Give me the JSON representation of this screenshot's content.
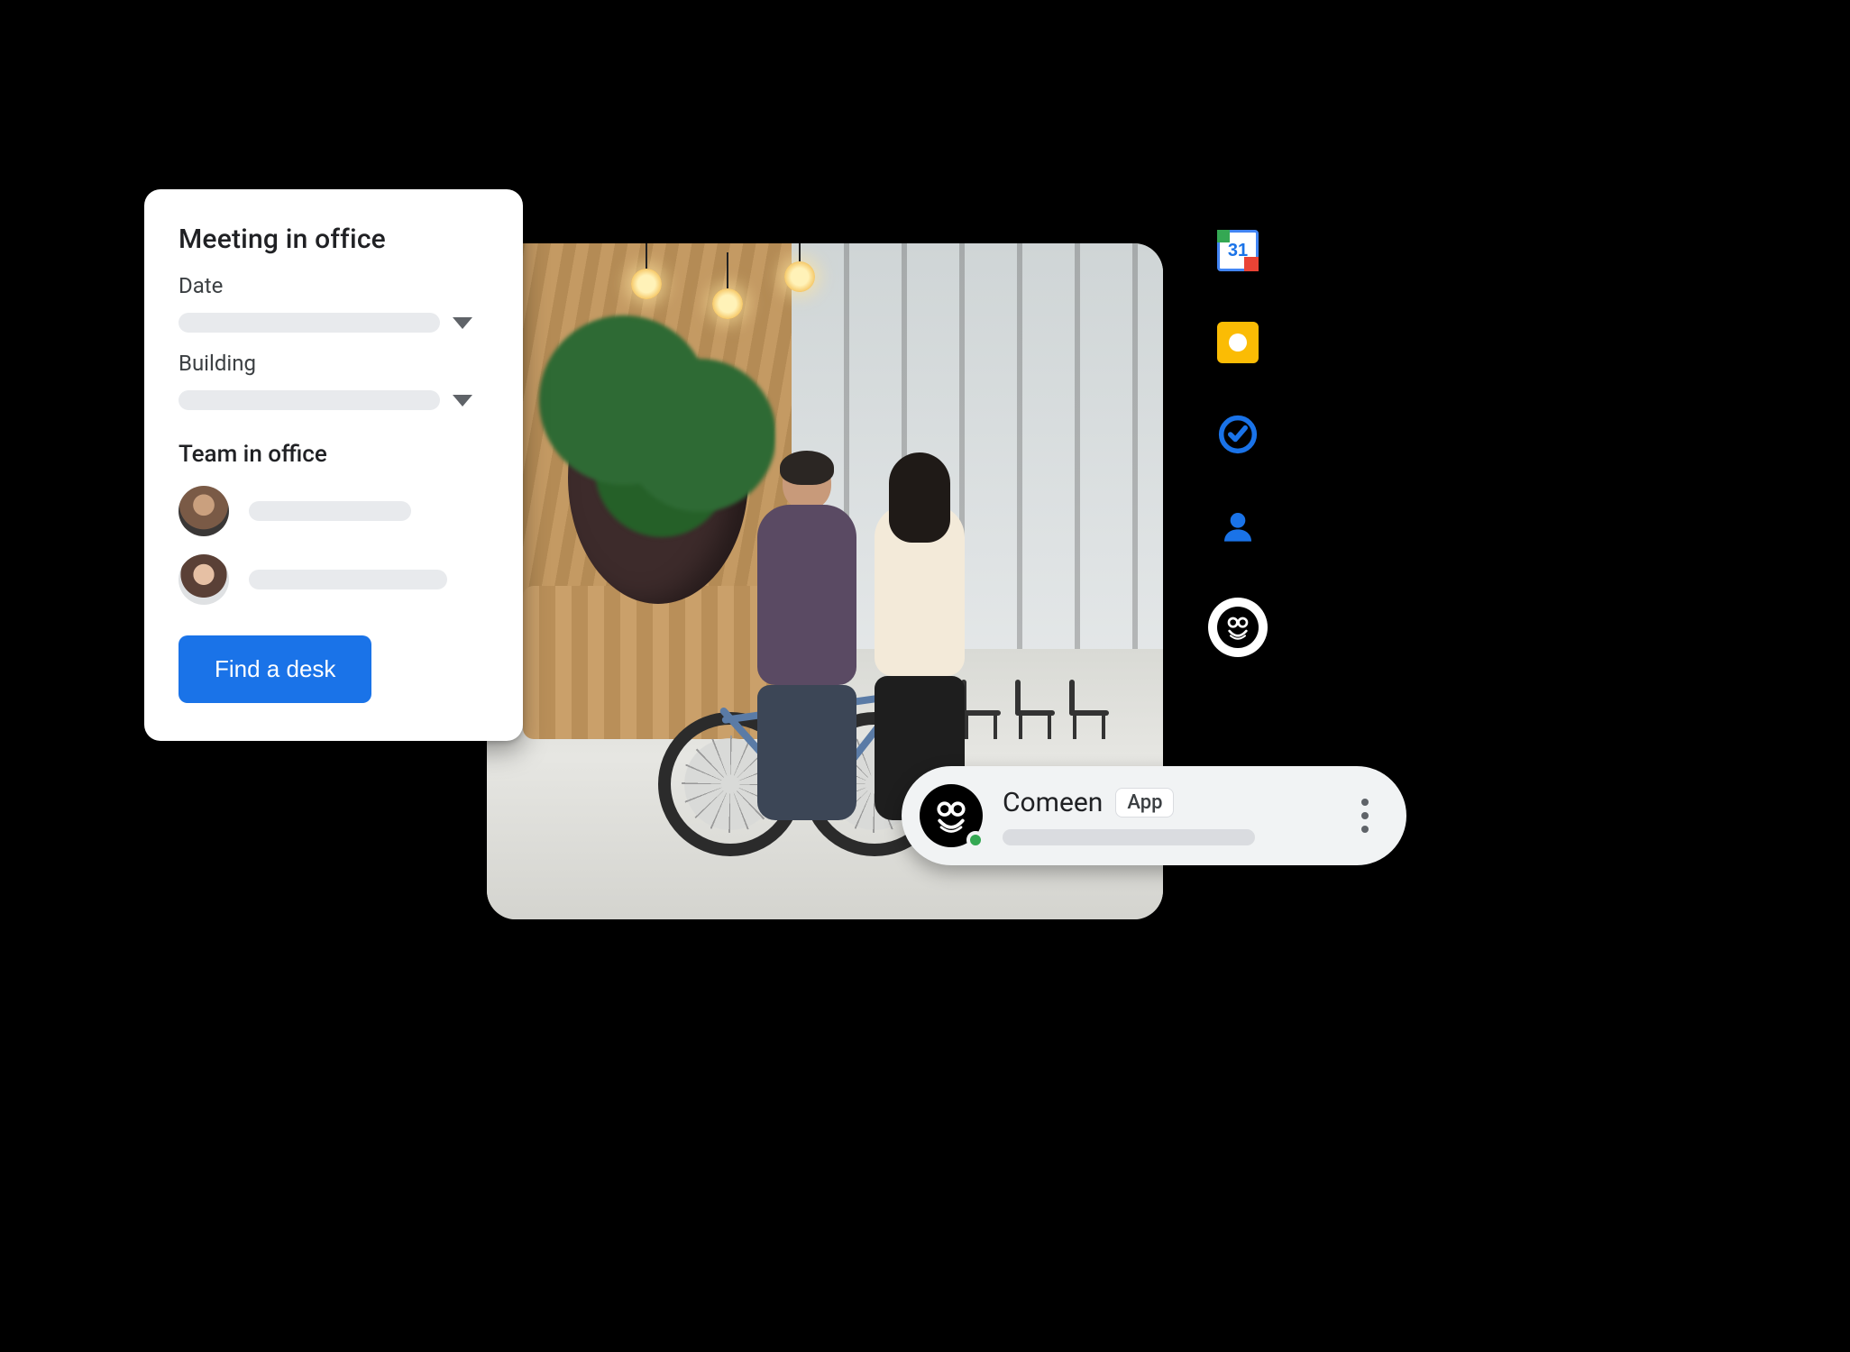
{
  "card": {
    "title": "Meeting in office",
    "date_label": "Date",
    "building_label": "Building",
    "team_section": "Team in office",
    "find_desk_label": "Find a desk"
  },
  "side_panel": {
    "calendar_day": "31",
    "items": [
      "google-calendar",
      "google-keep",
      "google-tasks",
      "google-contacts",
      "comeen"
    ]
  },
  "chat": {
    "app_name": "Comeen",
    "badge": "App"
  }
}
